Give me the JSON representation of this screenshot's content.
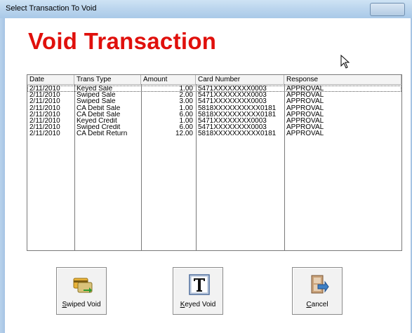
{
  "window": {
    "title": "Select Transaction To Void"
  },
  "heading": "Void Transaction",
  "table": {
    "columns": [
      "Date",
      "Trans Type",
      "Amount",
      "Card Number",
      "Response"
    ],
    "rows": [
      [
        "2/11/2010",
        "Keyed Sale",
        "1.00",
        "5471XXXXXXXX0003",
        "APPROVAL"
      ],
      [
        "2/11/2010",
        "Swiped Sale",
        "2.00",
        "5471XXXXXXXX0003",
        "APPROVAL"
      ],
      [
        "2/11/2010",
        "Swiped Sale",
        "3.00",
        "5471XXXXXXXX0003",
        "APPROVAL"
      ],
      [
        "2/11/2010",
        "CA Debit Sale",
        "1.00",
        "5818XXXXXXXXXX0181",
        "APPROVAL"
      ],
      [
        "2/11/2010",
        "CA Debit Sale",
        "6.00",
        "5818XXXXXXXXXX0181",
        "APPROVAL"
      ],
      [
        "2/11/2010",
        "Keyed Credit",
        "1.00",
        "5471XXXXXXXX0003",
        "APPROVAL"
      ],
      [
        "2/11/2010",
        "Swiped Credit",
        "6.00",
        "5471XXXXXXXX0003",
        "APPROVAL"
      ],
      [
        "2/11/2010",
        "CA Debit Return",
        "12.00",
        "5818XXXXXXXXXX0181",
        "APPROVAL"
      ]
    ],
    "selected_row": 0
  },
  "buttons": {
    "swiped_void": {
      "mnemonic": "S",
      "rest": "wiped Void"
    },
    "keyed_void": {
      "mnemonic": "K",
      "rest": "eyed Void"
    },
    "cancel": {
      "mnemonic": "C",
      "rest": "ancel"
    }
  },
  "icons": {
    "swiped_void": "card-swipe-icon",
    "keyed_void": "keyboard-T-icon",
    "cancel": "exit-door-icon"
  },
  "colors": {
    "heading": "#e0100c",
    "titlebar": "#bcd6ee"
  }
}
